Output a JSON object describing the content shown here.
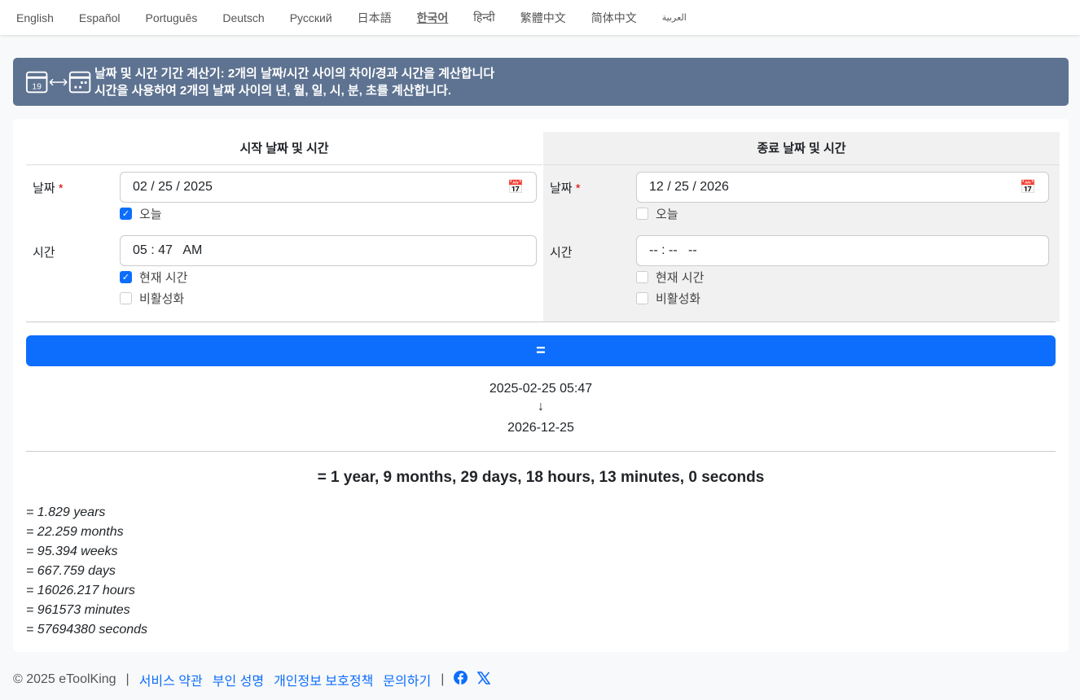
{
  "languages": [
    "English",
    "Español",
    "Português",
    "Deutsch",
    "Русский",
    "日本語",
    "한국어",
    "हिन्दी",
    "繁體中文",
    "简体中文",
    "العربية"
  ],
  "banner": {
    "line1": "날짜 및 시간 기간 계산기: 2개의 날짜/시간 사이의 차이/경과 시간을 계산합니다",
    "line2": "시간을 사용하여 2개의 날짜 사이의 년, 월, 일, 시, 분, 초를 계산합니다.",
    "icon_day": "19"
  },
  "start": {
    "title": "시작 날짜 및 시간",
    "date_label": "날짜",
    "required": "*",
    "date": "02 / 25 / 2025",
    "today": "오늘",
    "today_checked": true,
    "time_label": "시간",
    "time": "05 : 47   AM",
    "now": "현재 시간",
    "now_checked": true,
    "disable": "비활성화",
    "disable_checked": false
  },
  "end": {
    "title": "종료 날짜 및 시간",
    "date_label": "날짜",
    "required": "*",
    "date": "12 / 25 / 2026",
    "today": "오늘",
    "today_checked": false,
    "time_label": "시간",
    "time": "-- : --   --",
    "now": "현재 시간",
    "now_checked": false,
    "disable": "비활성화",
    "disable_checked": false
  },
  "calc_button": "=",
  "result": {
    "from": "2025-02-25 05:47",
    "arrow": "↓",
    "to": "2026-12-25",
    "summary": "= 1 year, 9 months, 29 days, 18 hours, 13 minutes, 0 seconds",
    "details": [
      "= 1.829 years",
      "= 22.259 months",
      "= 95.394 weeks",
      "= 667.759 days",
      "= 16026.217 hours",
      "= 961573 minutes",
      "= 57694380 seconds"
    ]
  },
  "footer": {
    "copyright": "© 2025 eToolKing",
    "sep": "|",
    "links": [
      "서비스 약관",
      "부인 성명",
      "개인정보 보호정책",
      "문의하기"
    ]
  }
}
